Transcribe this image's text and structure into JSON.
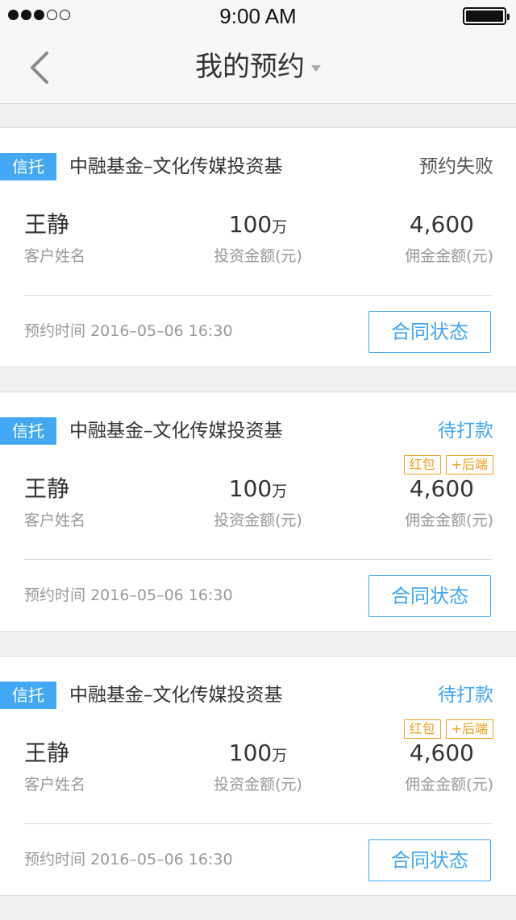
{
  "status_bar": {
    "time": "9:00 AM"
  },
  "nav": {
    "title": "我的预约"
  },
  "orders": [
    {
      "tag": "信托",
      "product": "中融基金–文化传媒投资基",
      "status": "预约失败",
      "status_type": "fail",
      "badges": [],
      "customer_name": "王静",
      "customer_label": "客户姓名",
      "amount": "100",
      "amount_unit": "万",
      "amount_label": "投资金额(元)",
      "commission": "4,600",
      "commission_label": "佣金金额(元)",
      "time_label": "预约时间",
      "time_value": "2016–05–06 16:30",
      "button": "合同状态"
    },
    {
      "tag": "信托",
      "product": "中融基金–文化传媒投资基",
      "status": "待打款",
      "status_type": "pending",
      "badges": [
        "红包",
        "+后端"
      ],
      "customer_name": "王静",
      "customer_label": "客户姓名",
      "amount": "100",
      "amount_unit": "万",
      "amount_label": "投资金额(元)",
      "commission": "4,600",
      "commission_label": "佣金金额(元)",
      "time_label": "预约时间",
      "time_value": "2016–05–06 16:30",
      "button": "合同状态"
    },
    {
      "tag": "信托",
      "product": "中融基金–文化传媒投资基",
      "status": "待打款",
      "status_type": "pending",
      "badges": [
        "红包",
        "+后端"
      ],
      "customer_name": "王静",
      "customer_label": "客户姓名",
      "amount": "100",
      "amount_unit": "万",
      "amount_label": "投资金额(元)",
      "commission": "4,600",
      "commission_label": "佣金金额(元)",
      "time_label": "预约时间",
      "time_value": "2016–05–06 16:30",
      "button": "合同状态"
    }
  ],
  "colors": {
    "accent": "#43a7f3",
    "badge": "#f0a020"
  }
}
